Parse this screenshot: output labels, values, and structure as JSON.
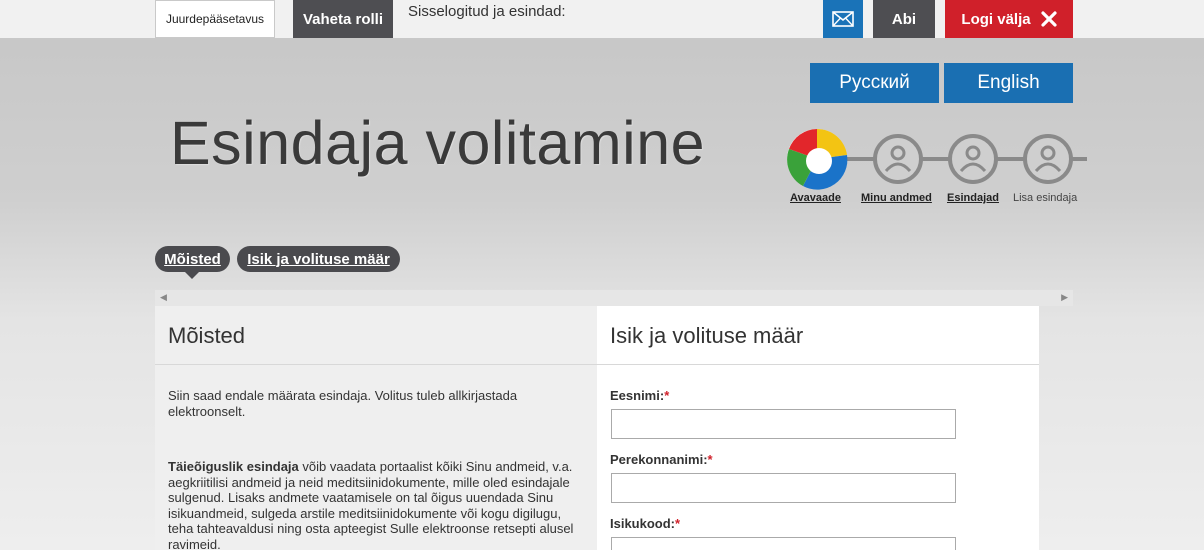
{
  "topbar": {
    "accessibility_label": "Juurdepääsetavus",
    "switch_role_label": "Vaheta rolli",
    "logged_in_label": "Sisselogitud ja esindad:",
    "help_label": "Abi",
    "logout_label": "Logi välja"
  },
  "languages": {
    "russian": "Русский",
    "english": "English"
  },
  "page": {
    "title": "Esindaja volitamine"
  },
  "steps": [
    {
      "label": "Avavaade"
    },
    {
      "label": "Minu andmed"
    },
    {
      "label": "Esindajad"
    },
    {
      "label": "Lisa esindaja"
    }
  ],
  "tabs": [
    {
      "label": "Mõisted"
    },
    {
      "label": "Isik ja volituse määr"
    }
  ],
  "left_panel": {
    "title": "Mõisted",
    "intro": "Siin saad endale määrata esindaja. Volitus tuleb allkirjastada elektroonselt.",
    "desc_bold": "Täieõiguslik esindaja",
    "desc_rest": " võib vaadata portaalist kõiki Sinu andmeid, v.a. aegkriitilisi andmeid ja neid meditsiinidokumente, mille oled esindajale sulgenud. Lisaks andmete vaatamisele on tal õigus uuendada Sinu isikuandmeid, sulgeda arstile meditsiinidokumente või kogu digilugu, teha tahteavaldusi ning osta apteegist Sulle elektroonse retsepti alusel ravimeid."
  },
  "right_panel": {
    "title": "Isik ja volituse määr",
    "fields": [
      {
        "label": "Eesnimi:",
        "required_mark": "*",
        "value": ""
      },
      {
        "label": "Perekonnanimi:",
        "required_mark": "*",
        "value": ""
      },
      {
        "label": "Isikukood:",
        "required_mark": "*",
        "value": ""
      }
    ]
  },
  "colors": {
    "blue": "#1a6fb2",
    "red": "#d0202a",
    "dark": "#4e4e52"
  }
}
